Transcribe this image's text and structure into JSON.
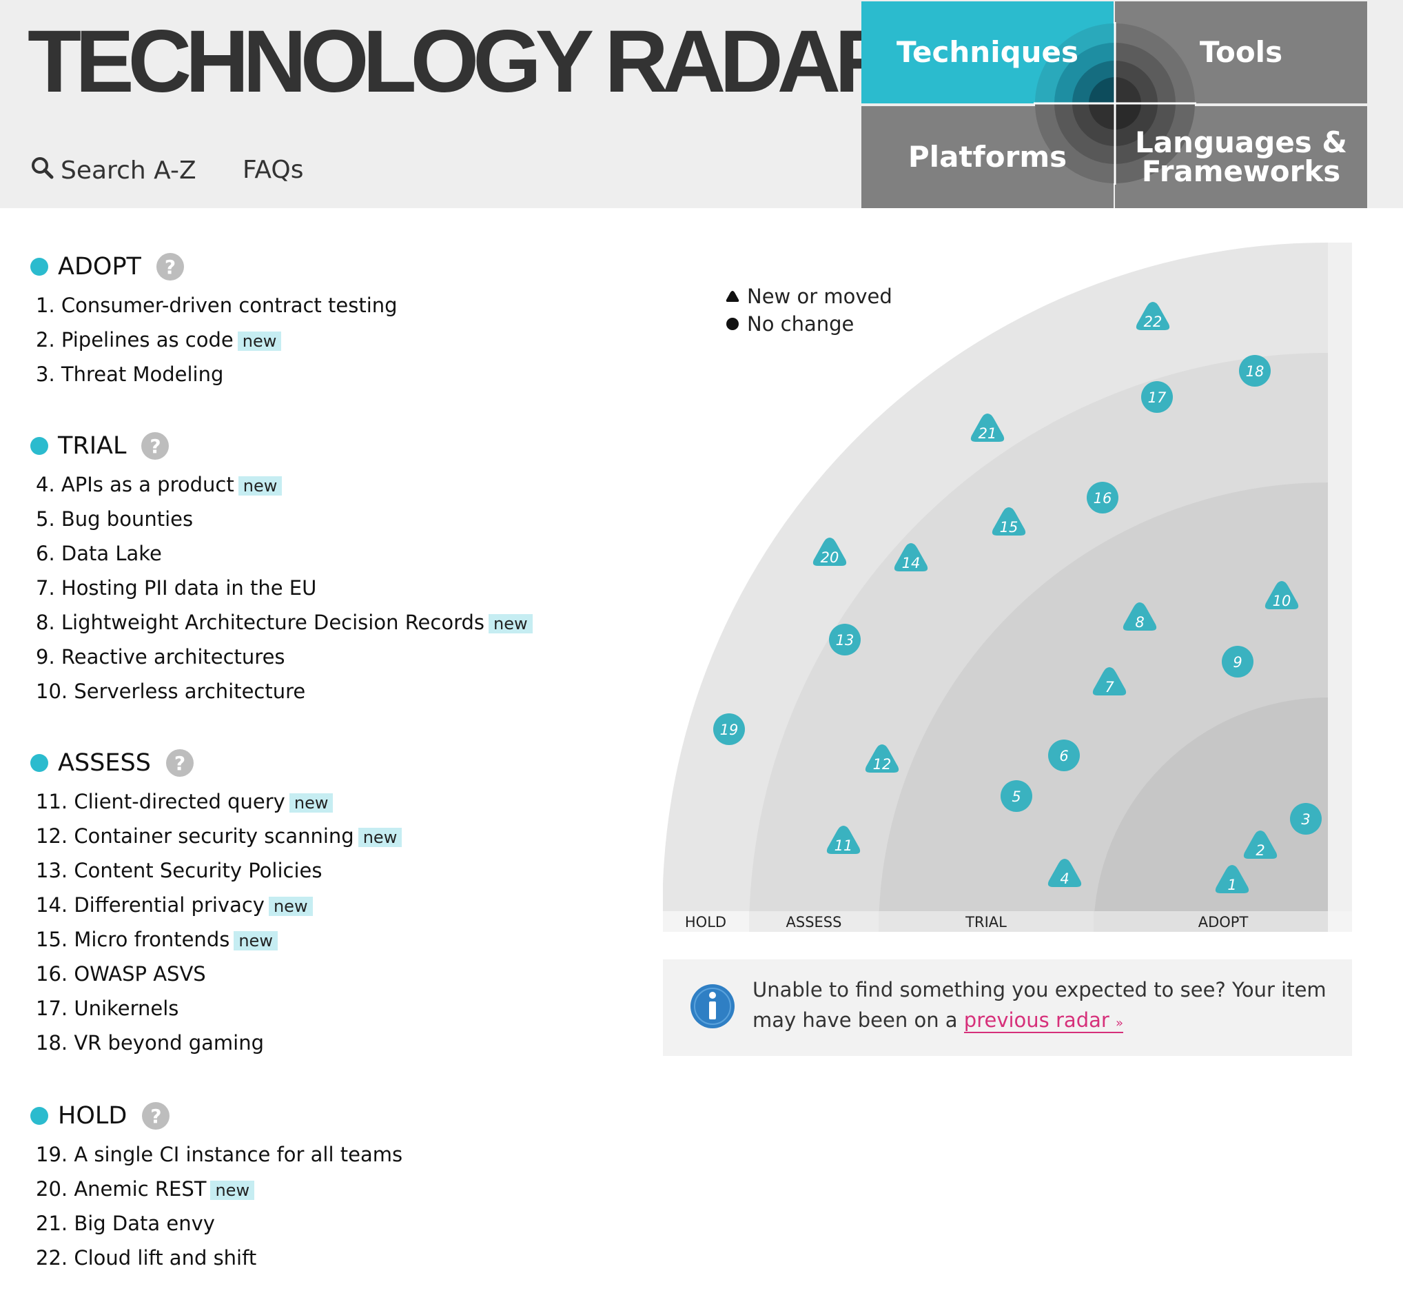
{
  "header": {
    "title": "TECHNOLOGY RADAR",
    "search_label": "Search A-Z",
    "faq_label": "FAQs"
  },
  "quadrants": {
    "techniques": "Techniques",
    "tools": "Tools",
    "platforms": "Platforms",
    "languages_line1": "Languages &",
    "languages_line2": "Frameworks"
  },
  "colors": {
    "accent": "#2bbbce",
    "tile_gray": "#808080",
    "new_badge_bg": "#c6edf2",
    "link": "#d6307a"
  },
  "new_badge_label": "new",
  "help_icon_glyph": "?",
  "rings": [
    {
      "name": "ADOPT",
      "items": [
        {
          "label": "1. Consumer-driven contract testing",
          "new": false
        },
        {
          "label": "2. Pipelines as code",
          "new": true
        },
        {
          "label": "3. Threat Modeling",
          "new": false
        }
      ]
    },
    {
      "name": "TRIAL",
      "items": [
        {
          "label": "4. APIs as a product",
          "new": true
        },
        {
          "label": "5. Bug bounties",
          "new": false
        },
        {
          "label": "6. Data Lake",
          "new": false
        },
        {
          "label": "7. Hosting PII data in the EU",
          "new": false
        },
        {
          "label": "8. Lightweight Architecture Decision Records",
          "new": true
        },
        {
          "label": "9. Reactive architectures",
          "new": false
        },
        {
          "label": "10. Serverless architecture",
          "new": false
        }
      ]
    },
    {
      "name": "ASSESS",
      "items": [
        {
          "label": "11. Client-directed query",
          "new": true
        },
        {
          "label": "12. Container security scanning",
          "new": true
        },
        {
          "label": "13. Content Security Policies",
          "new": false
        },
        {
          "label": "14. Differential privacy",
          "new": true
        },
        {
          "label": "15. Micro frontends",
          "new": true
        },
        {
          "label": "16. OWASP ASVS",
          "new": false
        },
        {
          "label": "17. Unikernels",
          "new": false
        },
        {
          "label": "18. VR beyond gaming",
          "new": false
        }
      ]
    },
    {
      "name": "HOLD",
      "items": [
        {
          "label": "19. A single CI instance for all teams",
          "new": false
        },
        {
          "label": "20. Anemic REST",
          "new": true
        },
        {
          "label": "21. Big Data envy",
          "new": false
        },
        {
          "label": "22. Cloud lift and shift",
          "new": false
        }
      ]
    }
  ],
  "legend": {
    "new_or_moved": "New or moved",
    "no_change": "No change"
  },
  "radar": {
    "ring_labels": [
      "HOLD",
      "ASSESS",
      "TRIAL",
      "ADOPT"
    ],
    "blips": [
      {
        "n": "1",
        "shape": "triangle"
      },
      {
        "n": "2",
        "shape": "triangle"
      },
      {
        "n": "3",
        "shape": "circle"
      },
      {
        "n": "4",
        "shape": "triangle"
      },
      {
        "n": "5",
        "shape": "circle"
      },
      {
        "n": "6",
        "shape": "circle"
      },
      {
        "n": "7",
        "shape": "triangle"
      },
      {
        "n": "8",
        "shape": "triangle"
      },
      {
        "n": "9",
        "shape": "circle"
      },
      {
        "n": "10",
        "shape": "triangle"
      },
      {
        "n": "11",
        "shape": "triangle"
      },
      {
        "n": "12",
        "shape": "triangle"
      },
      {
        "n": "13",
        "shape": "circle"
      },
      {
        "n": "14",
        "shape": "triangle"
      },
      {
        "n": "15",
        "shape": "triangle"
      },
      {
        "n": "16",
        "shape": "circle"
      },
      {
        "n": "17",
        "shape": "circle"
      },
      {
        "n": "18",
        "shape": "circle"
      },
      {
        "n": "19",
        "shape": "circle"
      },
      {
        "n": "20",
        "shape": "triangle"
      },
      {
        "n": "21",
        "shape": "triangle"
      },
      {
        "n": "22",
        "shape": "triangle"
      }
    ]
  },
  "info": {
    "text": "Unable to find something you expected to see? Your item may have been on a",
    "link_text": "previous radar",
    "link_chevron": "»"
  }
}
